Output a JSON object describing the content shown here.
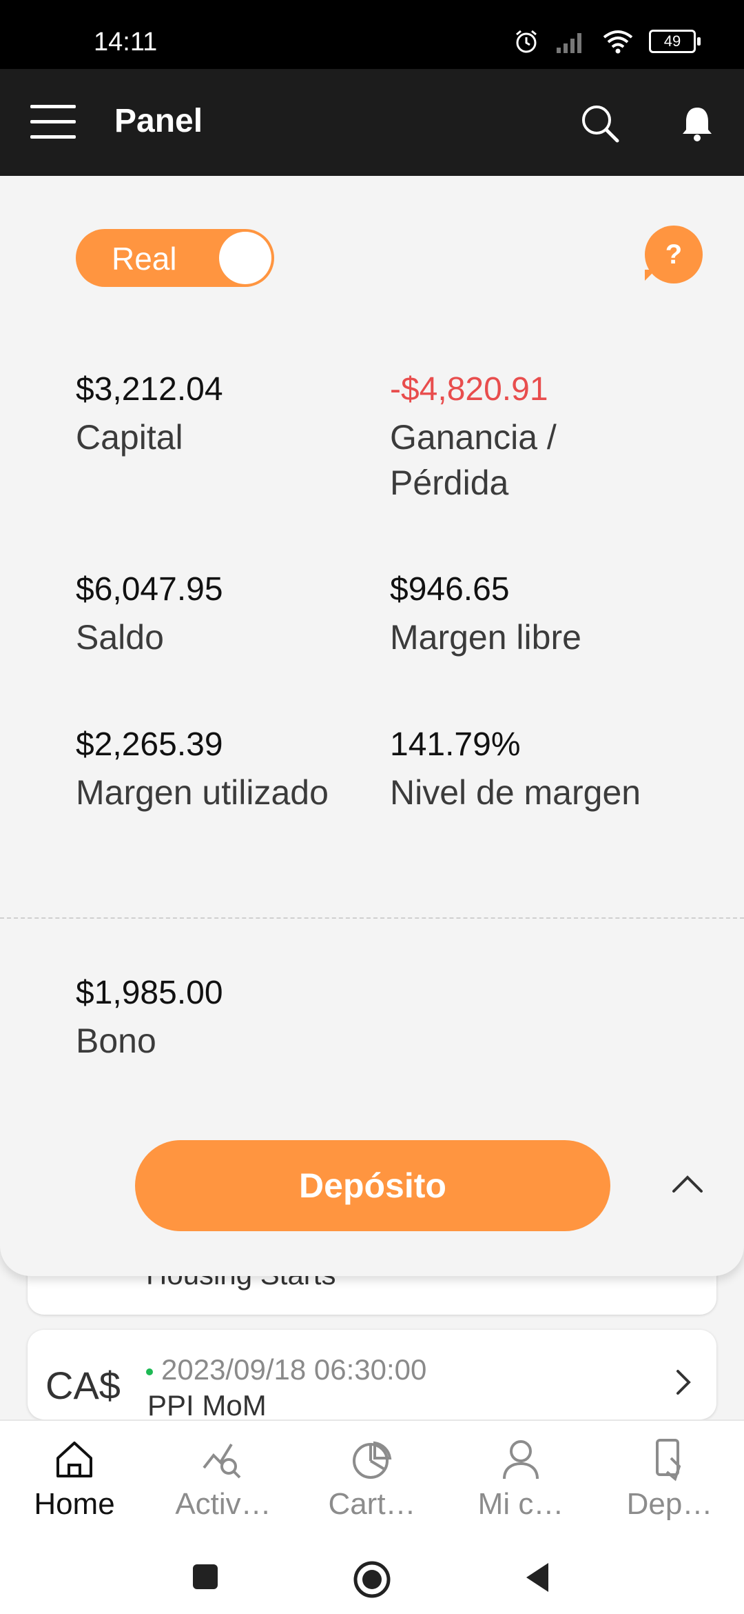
{
  "status": {
    "time": "14:11",
    "battery": "49"
  },
  "header": {
    "title": "Panel"
  },
  "panel": {
    "toggle_label": "Real",
    "help_label": "?",
    "stats": [
      {
        "value": "$3,212.04",
        "label": "Capital",
        "negative": false
      },
      {
        "value": "-$4,820.91",
        "label": "Ganancia / Pérdida",
        "negative": true
      },
      {
        "value": "$6,047.95",
        "label": "Saldo",
        "negative": false
      },
      {
        "value": "$946.65",
        "label": "Margen libre",
        "negative": false
      },
      {
        "value": "$2,265.39",
        "label": "Margen utilizado",
        "negative": false
      },
      {
        "value": "141.79%",
        "label": "Nivel de margen",
        "negative": false
      }
    ],
    "bonus": {
      "value": "$1,985.00",
      "label": "Bono"
    },
    "deposit_label": "Depósito"
  },
  "events": [
    {
      "currency": "",
      "date": "",
      "name": "Housing Starts"
    },
    {
      "currency": "CA$",
      "date": "2023/09/18 06:30:00",
      "name": "PPI MoM"
    }
  ],
  "bottom_nav": [
    {
      "label": "Home",
      "icon": "home-icon",
      "active": true
    },
    {
      "label": "Activ…",
      "icon": "chart-search-icon",
      "active": false
    },
    {
      "label": "Cart…",
      "icon": "pie-chart-icon",
      "active": false
    },
    {
      "label": "Mi c…",
      "icon": "person-icon",
      "active": false
    },
    {
      "label": "Dep…",
      "icon": "deposit-card-icon",
      "active": false
    }
  ],
  "colors": {
    "accent": "#ff9540",
    "negative": "#e84d4d",
    "header": "#1c1c1c"
  }
}
